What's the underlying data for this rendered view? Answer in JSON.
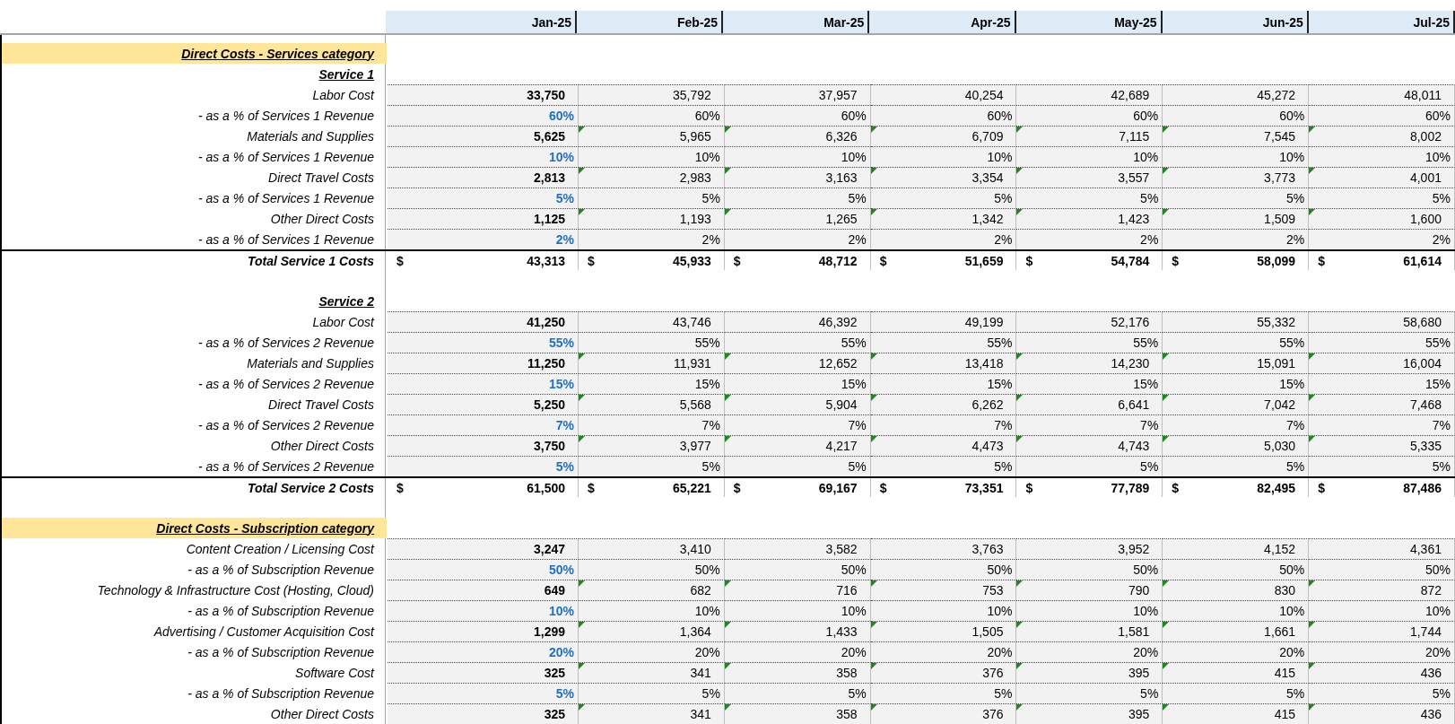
{
  "months": [
    "Jan-25",
    "Feb-25",
    "Mar-25",
    "Apr-25",
    "May-25",
    "Jun-25",
    "Jul-25"
  ],
  "rows": [
    {
      "kind": "category",
      "label": "Direct Costs - Services category"
    },
    {
      "kind": "group",
      "label": "Service 1"
    },
    {
      "kind": "value",
      "label": "Labor Cost",
      "values": [
        "33,750",
        "35,792",
        "37,957",
        "40,254",
        "42,689",
        "45,272",
        "48,011"
      ]
    },
    {
      "kind": "percent",
      "label": "- as a % of Services 1 Revenue",
      "values": [
        "60%",
        "60%",
        "60%",
        "60%",
        "60%",
        "60%",
        "60%"
      ]
    },
    {
      "kind": "value",
      "label": "Materials and Supplies",
      "flagged": true,
      "values": [
        "5,625",
        "5,965",
        "6,326",
        "6,709",
        "7,115",
        "7,545",
        "8,002"
      ]
    },
    {
      "kind": "percent",
      "label": "- as a % of Services 1 Revenue",
      "values": [
        "10%",
        "10%",
        "10%",
        "10%",
        "10%",
        "10%",
        "10%"
      ]
    },
    {
      "kind": "value",
      "label": "Direct Travel Costs",
      "flagged": true,
      "values": [
        "2,813",
        "2,983",
        "3,163",
        "3,354",
        "3,557",
        "3,773",
        "4,001"
      ]
    },
    {
      "kind": "percent",
      "label": "- as a % of Services 1 Revenue",
      "values": [
        "5%",
        "5%",
        "5%",
        "5%",
        "5%",
        "5%",
        "5%"
      ]
    },
    {
      "kind": "value",
      "label": "Other Direct Costs",
      "flagged": true,
      "values": [
        "1,125",
        "1,193",
        "1,265",
        "1,342",
        "1,423",
        "1,509",
        "1,600"
      ]
    },
    {
      "kind": "percent",
      "label": "- as a % of Services 1 Revenue",
      "values": [
        "2%",
        "2%",
        "2%",
        "2%",
        "2%",
        "2%",
        "2%"
      ]
    },
    {
      "kind": "total",
      "label": "Total Service 1 Costs",
      "symbols": [
        "$",
        "$",
        "$",
        "$",
        "$",
        "$",
        "$"
      ],
      "values": [
        "43,313",
        "45,933",
        "48,712",
        "51,659",
        "54,784",
        "58,099",
        "61,614"
      ]
    },
    {
      "kind": "blank"
    },
    {
      "kind": "group",
      "label": "Service 2"
    },
    {
      "kind": "value",
      "label": "Labor Cost",
      "values": [
        "41,250",
        "43,746",
        "46,392",
        "49,199",
        "52,176",
        "55,332",
        "58,680"
      ]
    },
    {
      "kind": "percent",
      "label": "- as a % of Services 2 Revenue",
      "values": [
        "55%",
        "55%",
        "55%",
        "55%",
        "55%",
        "55%",
        "55%"
      ]
    },
    {
      "kind": "value",
      "label": "Materials and Supplies",
      "flagged": true,
      "values": [
        "11,250",
        "11,931",
        "12,652",
        "13,418",
        "14,230",
        "15,091",
        "16,004"
      ]
    },
    {
      "kind": "percent",
      "label": "- as a % of Services 2 Revenue",
      "values": [
        "15%",
        "15%",
        "15%",
        "15%",
        "15%",
        "15%",
        "15%"
      ]
    },
    {
      "kind": "value",
      "label": "Direct Travel Costs",
      "flagged": true,
      "values": [
        "5,250",
        "5,568",
        "5,904",
        "6,262",
        "6,641",
        "7,042",
        "7,468"
      ]
    },
    {
      "kind": "percent",
      "label": "- as a % of Services 2 Revenue",
      "values": [
        "7%",
        "7%",
        "7%",
        "7%",
        "7%",
        "7%",
        "7%"
      ]
    },
    {
      "kind": "value",
      "label": "Other Direct Costs",
      "flagged": true,
      "values": [
        "3,750",
        "3,977",
        "4,217",
        "4,473",
        "4,743",
        "5,030",
        "5,335"
      ]
    },
    {
      "kind": "percent",
      "label": "- as a % of Services 2 Revenue",
      "values": [
        "5%",
        "5%",
        "5%",
        "5%",
        "5%",
        "5%",
        "5%"
      ]
    },
    {
      "kind": "total",
      "label": "Total Service 2 Costs",
      "symbols": [
        "$",
        "$",
        "$",
        "$",
        "$",
        "$",
        "$"
      ],
      "values": [
        "61,500",
        "65,221",
        "69,167",
        "73,351",
        "77,789",
        "82,495",
        "87,486"
      ]
    },
    {
      "kind": "blank"
    },
    {
      "kind": "category",
      "label": "Direct Costs - Subscription category"
    },
    {
      "kind": "value",
      "label": "Content Creation / Licensing Cost",
      "values": [
        "3,247",
        "3,410",
        "3,582",
        "3,763",
        "3,952",
        "4,152",
        "4,361"
      ]
    },
    {
      "kind": "percent",
      "label": "- as a % of Subscription Revenue",
      "values": [
        "50%",
        "50%",
        "50%",
        "50%",
        "50%",
        "50%",
        "50%"
      ]
    },
    {
      "kind": "value",
      "label": "Technology & Infrastructure Cost (Hosting, Cloud)",
      "flagged": true,
      "values": [
        "649",
        "682",
        "716",
        "753",
        "790",
        "830",
        "872"
      ]
    },
    {
      "kind": "percent",
      "label": "- as a % of Subscription Revenue",
      "values": [
        "10%",
        "10%",
        "10%",
        "10%",
        "10%",
        "10%",
        "10%"
      ]
    },
    {
      "kind": "value",
      "label": "Advertising / Customer Acquisition Cost",
      "flagged": true,
      "values": [
        "1,299",
        "1,364",
        "1,433",
        "1,505",
        "1,581",
        "1,661",
        "1,744"
      ]
    },
    {
      "kind": "percent",
      "label": "- as a % of Subscription Revenue",
      "values": [
        "20%",
        "20%",
        "20%",
        "20%",
        "20%",
        "20%",
        "20%"
      ]
    },
    {
      "kind": "value",
      "label": "Software Cost",
      "flagged": true,
      "values": [
        "325",
        "341",
        "358",
        "376",
        "395",
        "415",
        "436"
      ]
    },
    {
      "kind": "percent",
      "label": "- as a % of Subscription Revenue",
      "values": [
        "5%",
        "5%",
        "5%",
        "5%",
        "5%",
        "5%",
        "5%"
      ]
    },
    {
      "kind": "value",
      "label": "Other Direct Costs",
      "flagged": true,
      "values": [
        "325",
        "341",
        "358",
        "376",
        "395",
        "415",
        "436"
      ]
    }
  ]
}
